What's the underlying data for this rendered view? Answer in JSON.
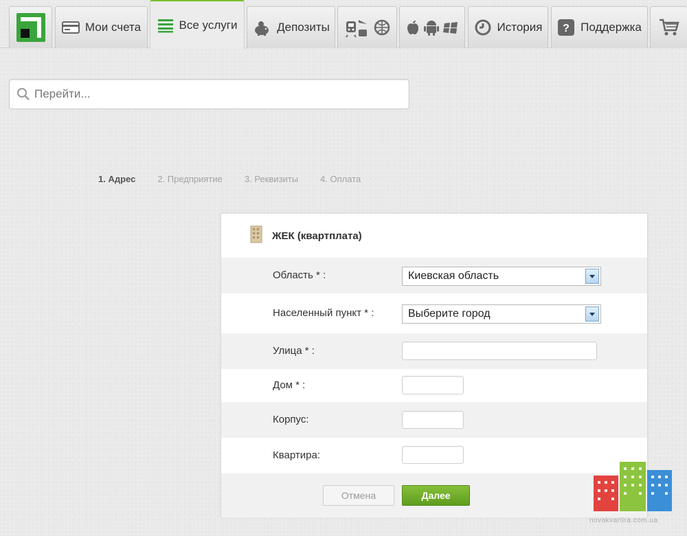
{
  "nav": {
    "tabs": [
      {
        "label": "Мои счета",
        "icon": "card-icon"
      },
      {
        "label": "Все услуги",
        "icon": "list-icon"
      },
      {
        "label": "Депозиты",
        "icon": "piggy-bank-icon"
      },
      {
        "label": "История",
        "icon": "history-icon"
      },
      {
        "label": "Поддержка",
        "icon": "help-icon"
      }
    ],
    "active_tab": "Все услуги",
    "accent_color": "#7bbf2a",
    "logo_color": "#3aa53c"
  },
  "search": {
    "placeholder": "Перейти..."
  },
  "steps": [
    {
      "label": "1. Адрес",
      "active": true
    },
    {
      "label": "2. Предприятие",
      "active": false
    },
    {
      "label": "3. Реквизиты",
      "active": false
    },
    {
      "label": "4. Оплата",
      "active": false
    }
  ],
  "form": {
    "title": "ЖЕК (квартплата)",
    "title_icon": "building-icon",
    "region_label": "Область * :",
    "region_value": "Киевская область",
    "city_label": "Населенный пункт * :",
    "city_value": "Выберите город",
    "street_label": "Улица * :",
    "house_label": "Дом * :",
    "block_label": "Корпус:",
    "apartment_label": "Квартира:",
    "cancel_label": "Отмена",
    "submit_label": "Далее"
  },
  "watermark": {
    "text": "novakvartira.com.ua"
  }
}
